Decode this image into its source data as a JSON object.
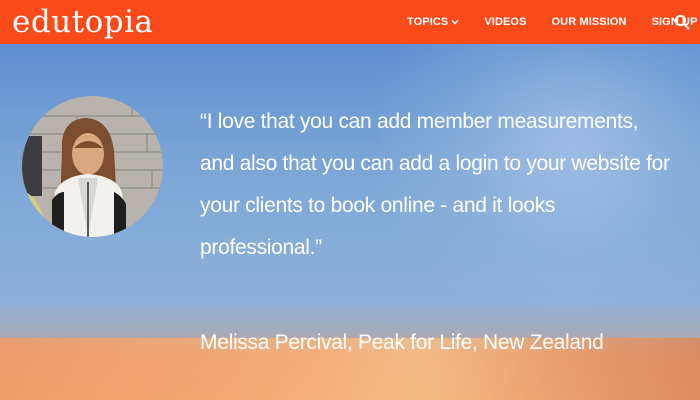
{
  "header": {
    "logo": "edutopia",
    "nav": [
      {
        "label": "TOPICS",
        "has_dropdown": true
      },
      {
        "label": "VIDEOS"
      },
      {
        "label": "OUR MISSION"
      },
      {
        "label": "SIGN UP"
      }
    ],
    "search_icon": "search-icon",
    "brand_color": "#fb4a1a"
  },
  "testimonial": {
    "quote": "“I love that you can add member measurements, and also that you can add a login to your website for your clients to book online - and it looks professional.”",
    "author": "Melissa Percival, Peak for Life, New Zealand"
  }
}
